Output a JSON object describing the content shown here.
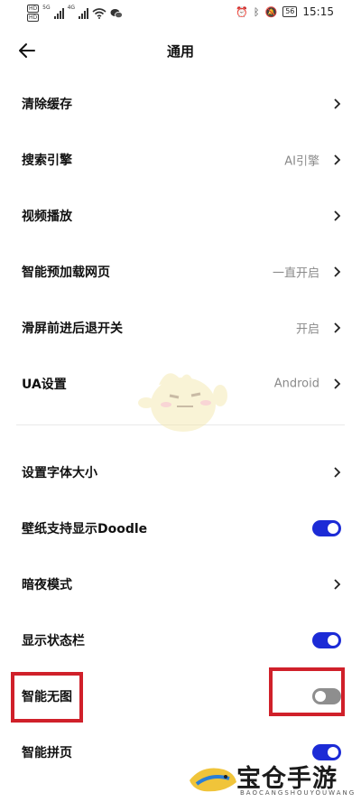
{
  "status_bar": {
    "hd1": "HD",
    "hd2": "HD",
    "sig1_label": "5G",
    "sig2_label": "4G",
    "battery": "56",
    "time": "15:15"
  },
  "header": {
    "title": "通用",
    "back_icon": "arrow-left-icon"
  },
  "rows": [
    {
      "label": "清除缓存",
      "value": "",
      "control": "chevron"
    },
    {
      "label": "搜索引擎",
      "value": "AI引擎",
      "control": "chevron"
    },
    {
      "label": "视频播放",
      "value": "",
      "control": "chevron"
    },
    {
      "label": "智能预加载网页",
      "value": "一直开启",
      "control": "chevron"
    },
    {
      "label": "滑屏前进后退开关",
      "value": "开启",
      "control": "chevron"
    },
    {
      "label": "UA设置",
      "value": "Android",
      "control": "chevron"
    },
    {
      "label": "设置字体大小",
      "value": "",
      "control": "chevron"
    },
    {
      "label": "壁纸支持显示Doodle",
      "value": "",
      "control": "toggle",
      "on": true
    },
    {
      "label": "暗夜模式",
      "value": "",
      "control": "chevron"
    },
    {
      "label": "显示状态栏",
      "value": "",
      "control": "toggle",
      "on": true
    },
    {
      "label": "智能无图",
      "value": "",
      "control": "toggle",
      "on": false
    },
    {
      "label": "智能拼页",
      "value": "",
      "control": "toggle",
      "on": true
    }
  ],
  "colors": {
    "toggle_on": "#1c2bd6",
    "toggle_off": "#8e8e8e",
    "highlight": "#d0202a"
  },
  "watermark": {
    "brand": "宝仓手游网",
    "brand_sub": "BAOCANGSHOUYOUWANG"
  }
}
